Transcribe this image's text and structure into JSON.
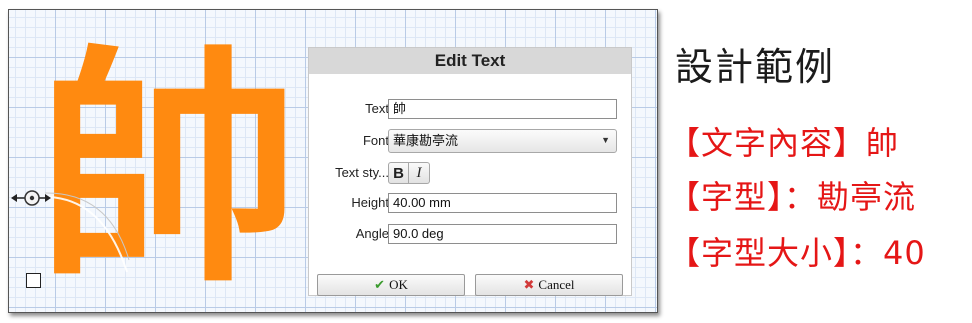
{
  "canvas": {
    "glyph": "帥",
    "glyph_color": "#ff8a10"
  },
  "dialog": {
    "title": "Edit Text",
    "fields": {
      "text_label": "Text",
      "text_value": "帥",
      "font_label": "Font",
      "font_value": "華康勘亭流",
      "style_label": "Text sty...",
      "bold_label": "B",
      "italic_label": "I",
      "height_label": "Height",
      "height_value": "40.00 mm",
      "angle_label": "Angle",
      "angle_value": "90.0 deg"
    },
    "ok_label": "OK",
    "cancel_label": "Cancel",
    "ok_icon": "check-icon",
    "cancel_icon": "x-icon"
  },
  "notes": {
    "title": "設計範例",
    "line1": "【文字內容】帥",
    "line2": "【字型】：勘亭流",
    "line3": "【字型大小】：40",
    "accent_color": "#e51616"
  }
}
